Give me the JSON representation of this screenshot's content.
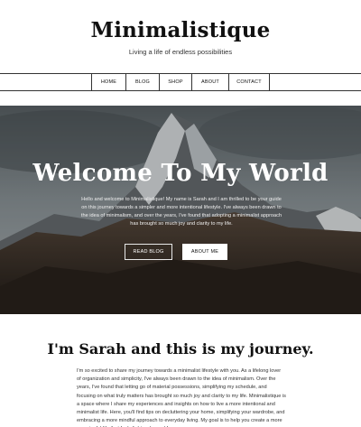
{
  "site": {
    "title": "Minimalistique",
    "tagline": "Living a life of endless possibilities"
  },
  "nav": {
    "items": [
      "HOME",
      "BLOG",
      "SHOP",
      "ABOUT",
      "CONTACT"
    ]
  },
  "hero": {
    "title": "Welcome To My World",
    "text": "Hello and welcome to Minimalistique! My name is Sarah and I am thrilled to be your guide on this journey towards a simpler and more intentional lifestyle. I've always been drawn to the idea of minimalism, and over the years, I've found that adopting a minimalist approach has brought so much joy and clarity to my life.",
    "read_blog_label": "READ BLOG",
    "about_me_label": "ABOUT ME"
  },
  "about": {
    "heading": "I'm Sarah and this is my journey.",
    "text": "I'm so excited to share my journey towards a minimalist lifestyle with you. As a lifelong lover of organization and simplicity, I've always been drawn to the idea of minimalism. Over the years, I've found that letting go of material possessions, simplifying my schedule, and focusing on what truly matters has brought so much joy and clarity to my life. Minimalistique is a space where I share my experiences and insights on how to live a more intentional and minimalist life. Here, you'll find tips on decluttering your home, simplifying your wardrobe, and embracing a more mindful approach to everyday living. My goal is to help you create a more meaningful life that feels light, calm and free."
  }
}
